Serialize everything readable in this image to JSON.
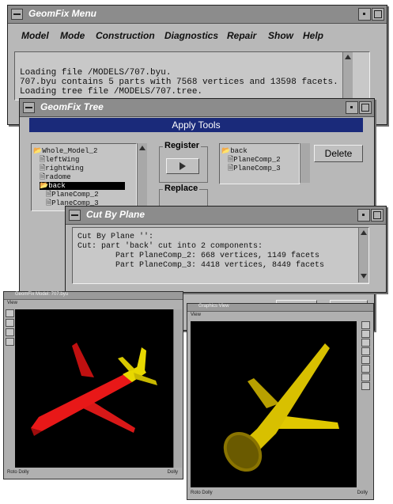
{
  "menu_window": {
    "title": "GeomFix Menu",
    "menus": [
      "Model",
      "Mode",
      "Construction",
      "Diagnostics",
      "Repair",
      "Show",
      "Help"
    ],
    "log_lines": [
      "Loading file /MODELS/707.byu.",
      "707.byu contains 5 parts with 7568 vertices and 13598 facets.",
      "Loading tree file /MODELS/707.tree."
    ]
  },
  "tree_window": {
    "title": "GeomFix Tree",
    "header": "Apply Tools",
    "tree_items": [
      "Whole_Model_2",
      "leftWing",
      "rightWing",
      "radome",
      "back",
      "PlaneComp_2",
      "PlaneComp_3"
    ],
    "selected_item": "back",
    "register_label": "Register",
    "replace_label": "Replace",
    "right_items": [
      "back",
      "PlaneComp_2",
      "PlaneComp_3"
    ],
    "delete_label": "Delete"
  },
  "cut_window": {
    "title": "Cut By Plane",
    "lines": [
      "Cut By Plane '':",
      "Cut: part 'back' cut into 2 components:",
      "        Part PlaneComp_2: 668 vertices, 1149 facets",
      "        Part PlaneComp_3: 4418 vertices, 8449 facets"
    ]
  },
  "viewer_left": {
    "title": "GeomFix Model: 707.byu",
    "menu": "View",
    "status_left": "Roto  Dolly",
    "status_right": "Dolly",
    "plane_color": "#e81818",
    "tail_color": "#e8d800"
  },
  "viewer_right": {
    "title": "Graphics View",
    "menu": "View",
    "status_left": "Roto  Dolly",
    "status_right": "Dolly",
    "plane_color": "#e0c800"
  },
  "colors": {
    "window_bg": "#b8b8b8",
    "titlebar": "#8c8c8c",
    "apply_header_bg": "#1a2a7a",
    "selection_bg": "#000000"
  }
}
